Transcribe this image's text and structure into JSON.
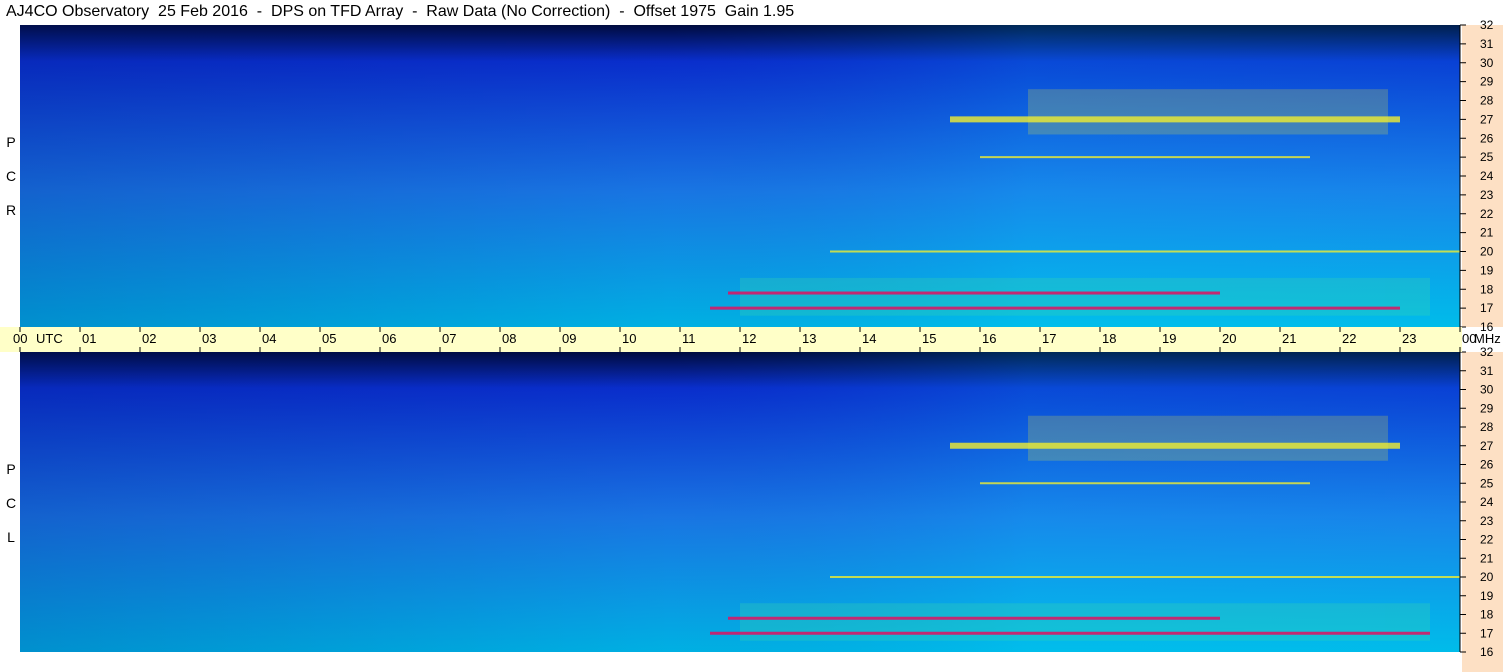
{
  "header": {
    "title": "AJ4CO Observatory  25 Feb 2016  -  DPS on TFD Array  -  Raw Data (No Correction)  -  Offset 1975  Gain 1.95"
  },
  "panels": {
    "top": {
      "label_letters": [
        "R",
        "C",
        "P"
      ]
    },
    "bottom": {
      "label_letters": [
        "L",
        "C",
        "P"
      ]
    }
  },
  "colors": {
    "background_top": "#000a3a",
    "low": "#0a2fd0",
    "mid": "#00b8e8",
    "high": "#f0ee30",
    "peak": "#e01060",
    "time_strip": "#ffffc8",
    "freq_strip": "#fde0c4"
  },
  "chart_data": [
    {
      "type": "heatmap",
      "name": "RCP",
      "x_axis": {
        "unit": "UTC",
        "tick_labels": [
          "00",
          "01",
          "02",
          "03",
          "04",
          "05",
          "06",
          "07",
          "08",
          "09",
          "10",
          "11",
          "12",
          "13",
          "14",
          "15",
          "16",
          "17",
          "18",
          "19",
          "20",
          "21",
          "22",
          "23",
          "00"
        ],
        "range_hours": [
          0,
          24
        ]
      },
      "y_axis": {
        "unit": "MHz",
        "tick_labels": [
          "16",
          "17",
          "18",
          "19",
          "20",
          "21",
          "22",
          "23",
          "24",
          "25",
          "26",
          "27",
          "28",
          "29",
          "30",
          "31",
          "32"
        ],
        "range_mhz": [
          16,
          32
        ]
      },
      "features": [
        {
          "desc": "strong intermittent lines",
          "freq_mhz": 17.0,
          "start_utc": 11.5,
          "end_utc": 23.0
        },
        {
          "desc": "strong intermittent lines",
          "freq_mhz": 17.8,
          "start_utc": 11.8,
          "end_utc": 20.0
        },
        {
          "desc": "line",
          "freq_mhz": 20.0,
          "start_utc": 13.5,
          "end_utc": 24.0
        },
        {
          "desc": "line",
          "freq_mhz": 25.0,
          "start_utc": 16.0,
          "end_utc": 21.5
        },
        {
          "desc": "band",
          "freq_mhz": 27.0,
          "start_utc": 15.5,
          "end_utc": 23.0
        }
      ]
    },
    {
      "type": "heatmap",
      "name": "LCP",
      "x_axis": {
        "unit": "UTC",
        "tick_labels": [
          "00",
          "01",
          "02",
          "03",
          "04",
          "05",
          "06",
          "07",
          "08",
          "09",
          "10",
          "11",
          "12",
          "13",
          "14",
          "15",
          "16",
          "17",
          "18",
          "19",
          "20",
          "21",
          "22",
          "23",
          "00"
        ],
        "range_hours": [
          0,
          24
        ]
      },
      "y_axis": {
        "unit": "MHz",
        "tick_labels": [
          "16",
          "17",
          "18",
          "19",
          "20",
          "21",
          "22",
          "23",
          "24",
          "25",
          "26",
          "27",
          "28",
          "29",
          "30",
          "31",
          "32"
        ],
        "range_mhz": [
          16,
          32
        ]
      },
      "features": [
        {
          "desc": "strong intermittent lines",
          "freq_mhz": 17.0,
          "start_utc": 11.5,
          "end_utc": 23.5
        },
        {
          "desc": "strong intermittent lines",
          "freq_mhz": 17.8,
          "start_utc": 11.8,
          "end_utc": 20.0
        },
        {
          "desc": "line",
          "freq_mhz": 20.0,
          "start_utc": 13.5,
          "end_utc": 24.0
        },
        {
          "desc": "line",
          "freq_mhz": 25.0,
          "start_utc": 16.0,
          "end_utc": 21.5
        },
        {
          "desc": "band",
          "freq_mhz": 27.0,
          "start_utc": 15.5,
          "end_utc": 23.0
        }
      ]
    }
  ],
  "time_axis": {
    "utc_label": "UTC",
    "mhz_label": "MHz"
  }
}
